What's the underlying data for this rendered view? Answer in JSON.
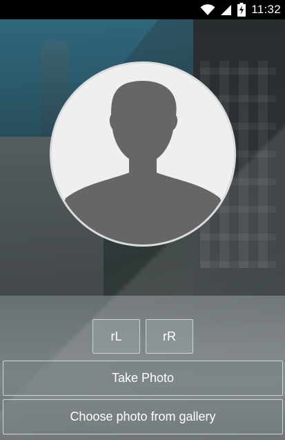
{
  "status_bar": {
    "time": "11:32",
    "icons": [
      "wifi-icon",
      "signal-icon",
      "battery-charging-icon"
    ]
  },
  "avatar": {
    "icon": "person-silhouette-icon"
  },
  "rotate": {
    "left_label": "rL",
    "right_label": "rR"
  },
  "actions": {
    "take_photo_label": "Take Photo",
    "gallery_label": "Choose photo from gallery"
  },
  "colors": {
    "status_bar_bg": "#000000",
    "avatar_bg": "#efefef",
    "silhouette": "#666666",
    "avatar_border": "#d9dcdc"
  }
}
